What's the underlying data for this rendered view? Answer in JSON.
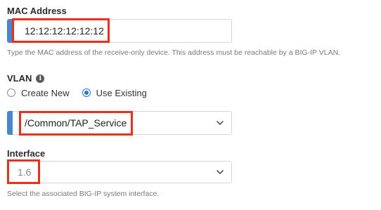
{
  "mac_section": {
    "label": "MAC Address",
    "value": "12:12:12:12:12:12",
    "help": "Type the MAC address of the receive-only device. This address must be reachable by a BIG-IP VLAN."
  },
  "vlan_section": {
    "label": "VLAN",
    "info_icon": "info-icon",
    "options": [
      {
        "label": "Create New",
        "selected": false
      },
      {
        "label": "Use Existing",
        "selected": true
      }
    ],
    "selected_value": "/Common/TAP_Service"
  },
  "interface_section": {
    "label": "Interface",
    "selected_value": "1.6",
    "help": "Select the associated BIG-IP system interface."
  },
  "colors": {
    "required_bar": "#4a86d0",
    "highlight": "#e8301c",
    "radio_selected": "#2b73d6"
  }
}
